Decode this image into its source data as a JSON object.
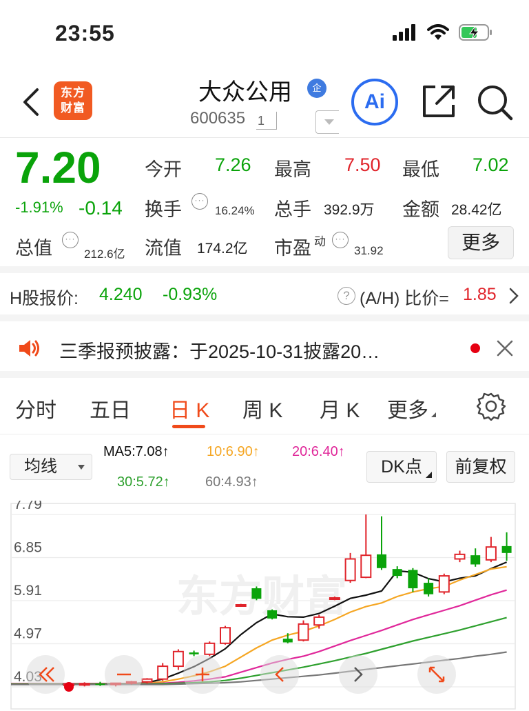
{
  "status_bar": {
    "time": "23:55"
  },
  "header": {
    "logo_text": "东方\n财富",
    "stock_name": "大众公用",
    "badge": "企",
    "stock_code": "600635",
    "code_mark": "1",
    "ai_label": "Ai"
  },
  "quote": {
    "price": "7.20",
    "change_pct": "-1.91%",
    "change": "-0.14",
    "open_label": "今开",
    "open": "7.26",
    "high_label": "最高",
    "high": "7.50",
    "low_label": "最低",
    "low": "7.02",
    "turnover_label": "换手",
    "turnover": "16.24%",
    "volume_label": "总手",
    "volume": "392.9万",
    "amount_label": "金额",
    "amount": "28.42亿",
    "total_cap_label": "总值",
    "total_cap": "212.6亿",
    "float_cap_label": "流值",
    "float_cap": "174.2亿",
    "pe_label": "市盈",
    "pe_sup": "动",
    "pe": "31.92",
    "more_label": "更多",
    "info_glyph": "···"
  },
  "h_share": {
    "label": "H股报价:",
    "price": "4.240",
    "change_pct": "-0.93%",
    "help_glyph": "?",
    "ah_label": "(A/H) 比价=",
    "ah_value": "1.85"
  },
  "notice": {
    "text": "三季报预披露：于2025-10-31披露20…"
  },
  "tabs": [
    {
      "label": "分时"
    },
    {
      "label": "五日"
    },
    {
      "label": "日 K"
    },
    {
      "label": "周 K"
    },
    {
      "label": "月 K"
    },
    {
      "label": "更多"
    }
  ],
  "ma_bar": {
    "select_label": "均线",
    "ma5": "MA5:7.08↑",
    "ma10": "10:6.90↑",
    "ma20": "20:6.40↑",
    "ma30": "30:5.72↑",
    "ma60": "60:4.93↑",
    "dk_label": "DK点",
    "fq_label": "前复权"
  },
  "colors": {
    "up": "#e0242b",
    "down": "#0aa30a",
    "accent": "#f04a1a",
    "ma5": "#111111",
    "ma10": "#f5a623",
    "ma20": "#e0289a",
    "ma30": "#2ea02e",
    "ma60": "#777777"
  },
  "chart_data": {
    "type": "candlestick",
    "y_ticks": [
      "7.79",
      "6.85",
      "5.91",
      "4.97",
      "4.03"
    ],
    "ylim": [
      4.03,
      7.79
    ],
    "watermark": "东方财富",
    "candles": [
      {
        "o": 4.06,
        "h": 4.12,
        "l": 4.02,
        "c": 4.09
      },
      {
        "o": 4.09,
        "h": 4.13,
        "l": 4.04,
        "c": 4.1
      },
      {
        "o": 4.1,
        "h": 4.14,
        "l": 4.05,
        "c": 4.08
      },
      {
        "o": 4.08,
        "h": 4.12,
        "l": 4.04,
        "c": 4.11
      },
      {
        "o": 4.11,
        "h": 4.16,
        "l": 4.08,
        "c": 4.14
      },
      {
        "o": 4.14,
        "h": 4.22,
        "l": 4.1,
        "c": 4.2
      },
      {
        "o": 4.2,
        "h": 4.55,
        "l": 4.16,
        "c": 4.48
      },
      {
        "o": 4.48,
        "h": 4.85,
        "l": 4.4,
        "c": 4.8
      },
      {
        "o": 4.78,
        "h": 4.82,
        "l": 4.7,
        "c": 4.74
      },
      {
        "o": 4.74,
        "h": 5.02,
        "l": 4.7,
        "c": 4.98
      },
      {
        "o": 4.98,
        "h": 5.36,
        "l": 4.95,
        "c": 5.32
      },
      {
        "o": 5.8,
        "h": 5.84,
        "l": 5.78,
        "c": 5.82
      },
      {
        "o": 6.18,
        "h": 6.22,
        "l": 5.92,
        "c": 5.95
      },
      {
        "o": 5.7,
        "h": 5.72,
        "l": 5.5,
        "c": 5.52
      },
      {
        "o": 5.08,
        "h": 5.2,
        "l": 4.98,
        "c": 5.0
      },
      {
        "o": 5.05,
        "h": 5.48,
        "l": 5.02,
        "c": 5.4
      },
      {
        "o": 5.38,
        "h": 5.6,
        "l": 5.3,
        "c": 5.55
      },
      {
        "o": 5.95,
        "h": 6.0,
        "l": 5.92,
        "c": 5.97
      },
      {
        "o": 6.35,
        "h": 6.95,
        "l": 6.3,
        "c": 6.82
      },
      {
        "o": 6.42,
        "h": 7.79,
        "l": 6.4,
        "c": 6.9
      },
      {
        "o": 6.92,
        "h": 7.75,
        "l": 6.58,
        "c": 6.62
      },
      {
        "o": 6.6,
        "h": 6.66,
        "l": 6.4,
        "c": 6.45
      },
      {
        "o": 6.58,
        "h": 6.62,
        "l": 6.1,
        "c": 6.18
      },
      {
        "o": 6.3,
        "h": 6.4,
        "l": 6.0,
        "c": 6.05
      },
      {
        "o": 6.1,
        "h": 6.5,
        "l": 6.05,
        "c": 6.45
      },
      {
        "o": 6.82,
        "h": 7.0,
        "l": 6.75,
        "c": 6.92
      },
      {
        "o": 6.9,
        "h": 7.05,
        "l": 6.65,
        "c": 6.7
      },
      {
        "o": 6.8,
        "h": 7.3,
        "l": 6.75,
        "c": 7.08
      },
      {
        "o": 7.1,
        "h": 7.4,
        "l": 6.78,
        "c": 6.95
      }
    ],
    "series": [
      {
        "name": "MA5",
        "values": [
          4.09,
          4.1,
          4.1,
          4.1,
          4.1,
          4.12,
          4.2,
          4.33,
          4.47,
          4.65,
          4.86,
          5.17,
          5.43,
          5.62,
          5.56,
          5.55,
          5.63,
          5.79,
          5.96,
          6.03,
          6.12,
          6.56,
          6.53,
          6.39,
          6.32,
          6.4,
          6.45,
          6.61,
          6.75
        ]
      },
      {
        "name": "10",
        "values": [
          4.1,
          4.1,
          4.1,
          4.1,
          4.1,
          4.11,
          4.14,
          4.2,
          4.27,
          4.36,
          4.48,
          4.68,
          4.88,
          5.05,
          5.16,
          5.24,
          5.36,
          5.5,
          5.66,
          5.78,
          5.86,
          6.0,
          6.1,
          6.17,
          6.22,
          6.36,
          6.48,
          6.6,
          6.65
        ]
      },
      {
        "name": "20",
        "values": [
          4.1,
          4.1,
          4.1,
          4.1,
          4.1,
          4.1,
          4.11,
          4.13,
          4.16,
          4.2,
          4.25,
          4.35,
          4.45,
          4.55,
          4.63,
          4.7,
          4.8,
          4.92,
          5.04,
          5.15,
          5.26,
          5.38,
          5.5,
          5.6,
          5.7,
          5.8,
          5.92,
          6.04,
          6.14
        ]
      },
      {
        "name": "30",
        "values": [
          4.09,
          4.09,
          4.09,
          4.09,
          4.09,
          4.09,
          4.1,
          4.11,
          4.12,
          4.14,
          4.17,
          4.22,
          4.28,
          4.34,
          4.4,
          4.46,
          4.53,
          4.6,
          4.68,
          4.76,
          4.85,
          4.94,
          5.03,
          5.11,
          5.19,
          5.27,
          5.36,
          5.45,
          5.54
        ]
      },
      {
        "name": "60",
        "values": [
          4.08,
          4.08,
          4.08,
          4.08,
          4.08,
          4.08,
          4.08,
          4.09,
          4.1,
          4.11,
          4.12,
          4.14,
          4.17,
          4.2,
          4.23,
          4.26,
          4.29,
          4.33,
          4.37,
          4.41,
          4.45,
          4.49,
          4.53,
          4.57,
          4.61,
          4.65,
          4.7,
          4.74,
          4.79
        ]
      }
    ]
  }
}
